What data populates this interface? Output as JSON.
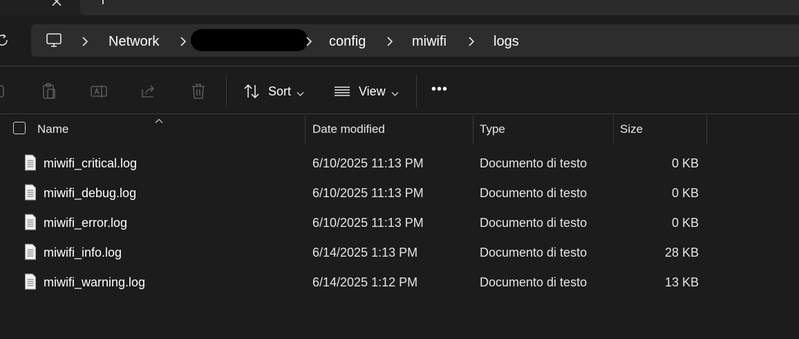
{
  "tab": {
    "close_glyph": "×"
  },
  "address_bar": {
    "crumbs": [
      "Network",
      "config",
      "miwifi",
      "logs"
    ],
    "redacted": true
  },
  "toolbar": {
    "sort_label": "Sort",
    "view_label": "View",
    "more_glyph": "•••"
  },
  "columns": {
    "name": "Name",
    "date": "Date modified",
    "type": "Type",
    "size": "Size"
  },
  "files": [
    {
      "name": "miwifi_critical.log",
      "date": "6/10/2025 11:13 PM",
      "type": "Documento di testo",
      "size": "0 KB"
    },
    {
      "name": "miwifi_debug.log",
      "date": "6/10/2025 11:13 PM",
      "type": "Documento di testo",
      "size": "0 KB"
    },
    {
      "name": "miwifi_error.log",
      "date": "6/10/2025 11:13 PM",
      "type": "Documento di testo",
      "size": "0 KB"
    },
    {
      "name": "miwifi_info.log",
      "date": "6/14/2025 1:13 PM",
      "type": "Documento di testo",
      "size": "28 KB"
    },
    {
      "name": "miwifi_warning.log",
      "date": "6/14/2025 1:12 PM",
      "type": "Documento di testo",
      "size": "13 KB"
    }
  ],
  "colors": {
    "background": "#1c1c1c",
    "address_bar": "#2d2d2d",
    "text": "#ffffff"
  }
}
